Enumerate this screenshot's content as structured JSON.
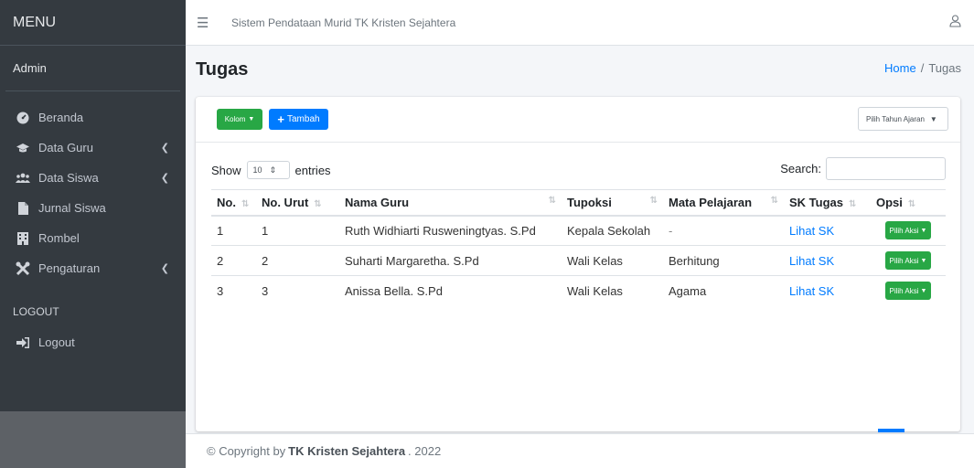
{
  "sidebar": {
    "brand": "MENU",
    "user": "Admin",
    "items": [
      {
        "label": "Beranda",
        "icon": "dashboard-icon",
        "has_caret": false
      },
      {
        "label": "Data Guru",
        "icon": "graduation-cap-icon",
        "has_caret": true
      },
      {
        "label": "Data Siswa",
        "icon": "users-icon",
        "has_caret": true
      },
      {
        "label": "Jurnal Siswa",
        "icon": "file-icon",
        "has_caret": false
      },
      {
        "label": "Rombel",
        "icon": "building-icon",
        "has_caret": false
      },
      {
        "label": "Pengaturan",
        "icon": "tools-icon",
        "has_caret": true
      }
    ],
    "section_header": "LOGOUT",
    "logout_label": "Logout"
  },
  "navbar": {
    "title": "Sistem Pendataan Murid TK Kristen Sejahtera"
  },
  "header": {
    "page_title": "Tugas",
    "breadcrumb_home": "Home",
    "breadcrumb_sep": "/",
    "breadcrumb_current": "Tugas"
  },
  "toolbar": {
    "kolom_label": "Kolom",
    "tambah_label": "Tambah",
    "tahun_label": "Pilih Tahun Ajaran"
  },
  "table_controls": {
    "show_label": "Show",
    "entries_value": "10",
    "entries_label": "entries",
    "search_label": "Search:"
  },
  "table": {
    "columns": [
      "No.",
      "No. Urut",
      "Nama Guru",
      "Tupoksi",
      "Mata Pelajaran",
      "SK Tugas",
      "Opsi"
    ],
    "rows": [
      {
        "no": "1",
        "urut": "1",
        "nama": "Ruth Widhiarti Rusweningtyas. S.Pd",
        "tupoksi": "Kepala Sekolah",
        "mapel": "-",
        "sk": "Lihat SK",
        "opsi": "Pilih Aksi"
      },
      {
        "no": "2",
        "urut": "2",
        "nama": "Suharti Margaretha. S.Pd",
        "tupoksi": "Wali Kelas",
        "mapel": "Berhitung",
        "sk": "Lihat SK",
        "opsi": "Pilih Aksi"
      },
      {
        "no": "3",
        "urut": "3",
        "nama": "Anissa Bella. S.Pd",
        "tupoksi": "Wali Kelas",
        "mapel": "Agama",
        "sk": "Lihat SK",
        "opsi": "Pilih Aksi"
      }
    ]
  },
  "footer": {
    "prefix": "© Copyright by",
    "brand": "TK Kristen Sejahtera",
    "suffix": ". 2022"
  },
  "colors": {
    "sidebar_bg": "#343a40",
    "primary": "#007bff",
    "success": "#28a745"
  }
}
